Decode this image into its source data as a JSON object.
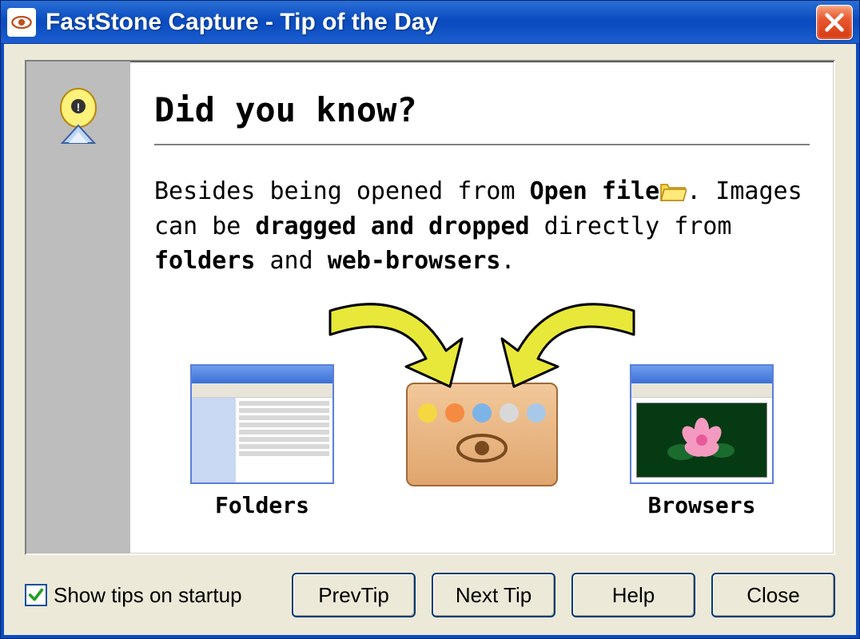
{
  "window": {
    "title": "FastStone Capture - Tip of the Day"
  },
  "content": {
    "heading": "Did you know?",
    "tip": {
      "part1": "Besides being opened from ",
      "bold1": "Open file",
      "part2": ". Images can be ",
      "bold2": "dragged and dropped",
      "part3": " directly from ",
      "bold3": "folders",
      "part4": " and ",
      "bold4": "web-browsers",
      "part5": "."
    },
    "labels": {
      "folders": "Folders",
      "browsers": "Browsers"
    }
  },
  "footer": {
    "checkbox_label": "Show tips on startup",
    "checkbox_checked": true,
    "buttons": {
      "prev": "PrevTip",
      "next": "Next Tip",
      "help": "Help",
      "close": "Close"
    }
  }
}
